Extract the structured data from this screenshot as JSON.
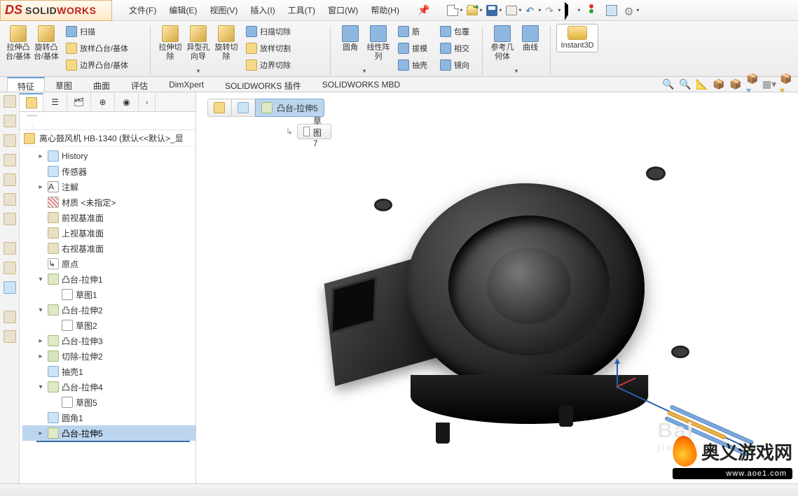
{
  "app": {
    "solid": "SOLID",
    "works": "WORKS"
  },
  "menu": {
    "file": "文件(F)",
    "edit": "编辑(E)",
    "view": "视图(V)",
    "insert": "插入(I)",
    "tools": "工具(T)",
    "window": "窗口(W)",
    "help": "帮助(H)"
  },
  "ribbon": {
    "extrude": "拉伸凸\n台/基体",
    "revolve": "旋转凸\n台/基体",
    "sweep": "扫描",
    "loft": "放样凸台/基体",
    "boundary": "边界凸台/基体",
    "extrudecut": "拉伸切\n除",
    "holewiz": "异型孔\n向导",
    "revcut": "旋转切\n除",
    "sweepcut": "扫描切除",
    "loftcut": "放样切割",
    "boundcut": "边界切除",
    "fillet": "圆角",
    "linpat": "线性阵\n列",
    "rib": "筋",
    "wrap": "包覆",
    "draft": "拔模",
    "intersect": "相交",
    "shell": "抽壳",
    "mirror": "镜向",
    "refgeo": "参考几\n何体",
    "curves": "曲线",
    "instant3d": "Instant3D"
  },
  "tabs": {
    "feature": "特征",
    "sketch": "草图",
    "surface": "曲面",
    "evaluate": "评估",
    "dimxpert": "DimXpert",
    "swaddin": "SOLIDWORKS 插件",
    "mbd": "SOLIDWORKS MBD"
  },
  "tree": {
    "root": "离心鼓风机 HB-1340  (默认<<默认>_显",
    "history": "History",
    "sensors": "传感器",
    "annotations": "注解",
    "material": "材质 <未指定>",
    "front": "前视基准面",
    "top": "上视基准面",
    "right": "右视基准面",
    "origin": "原点",
    "f1": "凸台-拉伸1",
    "s1": "草图1",
    "f2": "凸台-拉伸2",
    "s2": "草图2",
    "f3": "凸台-拉伸3",
    "cut2": "切除-拉伸2",
    "shell1": "抽壳1",
    "f4": "凸台-拉伸4",
    "s5": "草图5",
    "fillet1": "圆角1",
    "f5": "凸台-拉伸5"
  },
  "crumb": {
    "feature": "凸台-拉伸5",
    "sketch": "草图7"
  },
  "watermark": {
    "name": "奥义游戏网",
    "url": "www.aoe1.com",
    "faint": "Bai",
    "faint2": "jingya"
  }
}
